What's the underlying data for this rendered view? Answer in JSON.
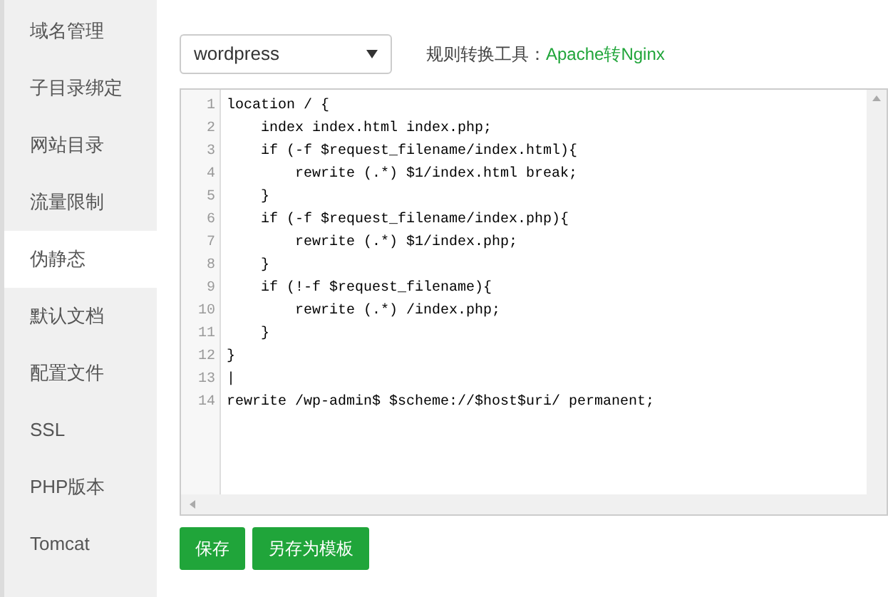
{
  "sidebar": {
    "items": [
      {
        "label": "域名管理",
        "selected": false
      },
      {
        "label": "子目录绑定",
        "selected": false
      },
      {
        "label": "网站目录",
        "selected": false
      },
      {
        "label": "流量限制",
        "selected": false
      },
      {
        "label": "伪静态",
        "selected": true
      },
      {
        "label": "默认文档",
        "selected": false
      },
      {
        "label": "配置文件",
        "selected": false
      },
      {
        "label": "SSL",
        "selected": false
      },
      {
        "label": "PHP版本",
        "selected": false
      },
      {
        "label": "Tomcat",
        "selected": false
      }
    ]
  },
  "template_select": {
    "value": "wordpress"
  },
  "converter": {
    "label": "规则转换工具：",
    "link": "Apache转Nginx"
  },
  "editor": {
    "lines": [
      {
        "number": "1",
        "code": "location / {"
      },
      {
        "number": "2",
        "code": "    index index.html index.php;"
      },
      {
        "number": "3",
        "code": "    if (-f $request_filename/index.html){"
      },
      {
        "number": "4",
        "code": "        rewrite (.*) $1/index.html break;"
      },
      {
        "number": "5",
        "code": "    }"
      },
      {
        "number": "6",
        "code": "    if (-f $request_filename/index.php){"
      },
      {
        "number": "7",
        "code": "        rewrite (.*) $1/index.php;"
      },
      {
        "number": "8",
        "code": "    }"
      },
      {
        "number": "9",
        "code": "    if (!-f $request_filename){"
      },
      {
        "number": "10",
        "code": "        rewrite (.*) /index.php;"
      },
      {
        "number": "11",
        "code": "    }"
      },
      {
        "number": "12",
        "code": "}"
      },
      {
        "number": "13",
        "code": "|"
      },
      {
        "number": "14",
        "code": "rewrite /wp-admin$ $scheme://$host$uri/ permanent;"
      }
    ]
  },
  "buttons": [
    "保存",
    "另存为模板"
  ]
}
